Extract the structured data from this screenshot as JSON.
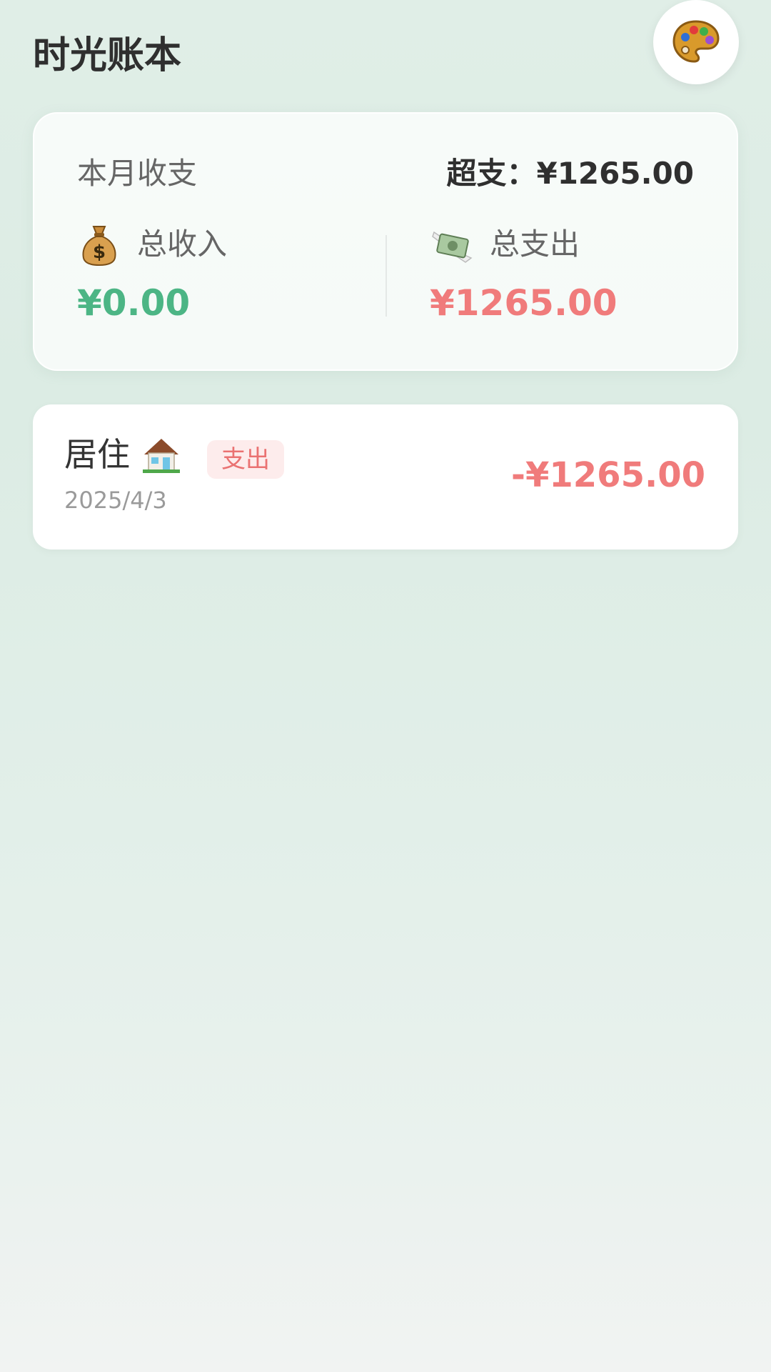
{
  "app": {
    "title": "时光账本",
    "theme_icon": "palette-icon"
  },
  "summary": {
    "title": "本月收支",
    "overspend_label": "超支：",
    "overspend_value": "¥1265.00",
    "income": {
      "icon": "money-bag-icon",
      "label": "总收入",
      "value": "¥0.00"
    },
    "expense": {
      "icon": "money-wings-icon",
      "label": "总支出",
      "value": "¥1265.00"
    }
  },
  "records": [
    {
      "category": "居住",
      "category_icon": "house-icon",
      "type": "支出",
      "date": "2025/4/3",
      "amount": "-¥1265.00"
    }
  ],
  "colors": {
    "income": "#4cb585",
    "expense": "#f07b7b",
    "badge_bg": "#fdecec",
    "background": "#dcece4"
  }
}
